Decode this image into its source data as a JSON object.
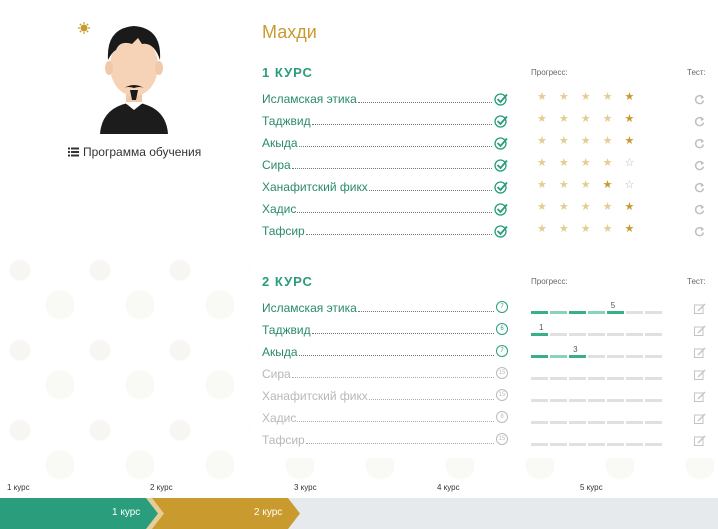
{
  "user": {
    "name": "Махди"
  },
  "program_link": "Программа обучения",
  "course1": {
    "title": "1 КУРС",
    "progress_label": "Прогресс:",
    "test_label": "Тест:",
    "subjects": [
      {
        "name": "Исламская этика",
        "stars": [
          1,
          1,
          1,
          1,
          2
        ]
      },
      {
        "name": "Таджвид",
        "stars": [
          1,
          1,
          1,
          1,
          2
        ]
      },
      {
        "name": "Акыда",
        "stars": [
          1,
          1,
          1,
          1,
          2
        ]
      },
      {
        "name": "Сира",
        "stars": [
          1,
          1,
          1,
          1,
          0
        ]
      },
      {
        "name": "Ханафитский фикх",
        "stars": [
          1,
          1,
          1,
          2,
          0
        ]
      },
      {
        "name": "Хадис",
        "stars": [
          1,
          1,
          1,
          1,
          2
        ]
      },
      {
        "name": "Тафсир",
        "stars": [
          1,
          1,
          1,
          1,
          2
        ]
      }
    ]
  },
  "course2": {
    "title": "2 КУРС",
    "progress_label": "Прогресс:",
    "test_label": "Тест:",
    "subjects": [
      {
        "name": "Исламская этика",
        "badge": "7",
        "progress": 5,
        "total": 7,
        "value_label": "5",
        "active": true
      },
      {
        "name": "Таджвид",
        "badge": "6",
        "progress": 1,
        "total": 6,
        "value_label": "1",
        "active": true
      },
      {
        "name": "Акыда",
        "badge": "7",
        "progress": 3,
        "total": 7,
        "value_label": "3",
        "active": true
      },
      {
        "name": "Сира",
        "badge": "15",
        "progress": 0,
        "total": 15,
        "value_label": "",
        "active": false
      },
      {
        "name": "Ханафитский фикх",
        "badge": "15",
        "progress": 0,
        "total": 15,
        "value_label": "",
        "active": false
      },
      {
        "name": "Хадис",
        "badge": "8",
        "progress": 0,
        "total": 8,
        "value_label": "",
        "active": false
      },
      {
        "name": "Тафсир",
        "badge": "15",
        "progress": 0,
        "total": 15,
        "value_label": "",
        "active": false
      }
    ]
  },
  "timeline": {
    "labels": [
      "1 курс",
      "2 курс",
      "3 курс",
      "4 курс",
      "5 курс"
    ],
    "steps": [
      {
        "label": "1 курс",
        "color": "#2a9d7c"
      },
      {
        "label": "2 курс",
        "color": "#c99a2e"
      }
    ]
  },
  "colors": {
    "accent_green": "#2a9d7c",
    "accent_gold": "#c99a2e"
  }
}
